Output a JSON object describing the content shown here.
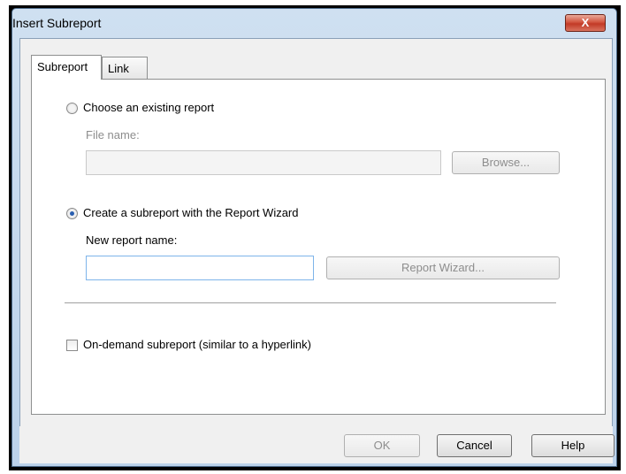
{
  "window": {
    "title": "Insert Subreport",
    "close_label": "X"
  },
  "tabs": [
    {
      "label": "Subreport",
      "active": true
    },
    {
      "label": "Link",
      "active": false
    }
  ],
  "existing": {
    "radio_label": "Choose an existing report",
    "selected": false,
    "file_label": "File name:",
    "file_value": "",
    "browse_label": "Browse..."
  },
  "wizard": {
    "radio_label": "Create a subreport with the Report Wizard",
    "selected": true,
    "name_label": "New report name:",
    "name_value": "",
    "wizard_button_label": "Report Wizard..."
  },
  "on_demand": {
    "label": "On-demand subreport (similar to a hyperlink)",
    "checked": false
  },
  "buttons": {
    "ok": "OK",
    "cancel": "Cancel",
    "help": "Help"
  },
  "colors": {
    "accent": "#2a5fb0",
    "close": "#c23a26",
    "titlebar": "#c3d7ec"
  },
  "icons": [
    "close-icon",
    "radio-icon",
    "checkbox-icon"
  ]
}
